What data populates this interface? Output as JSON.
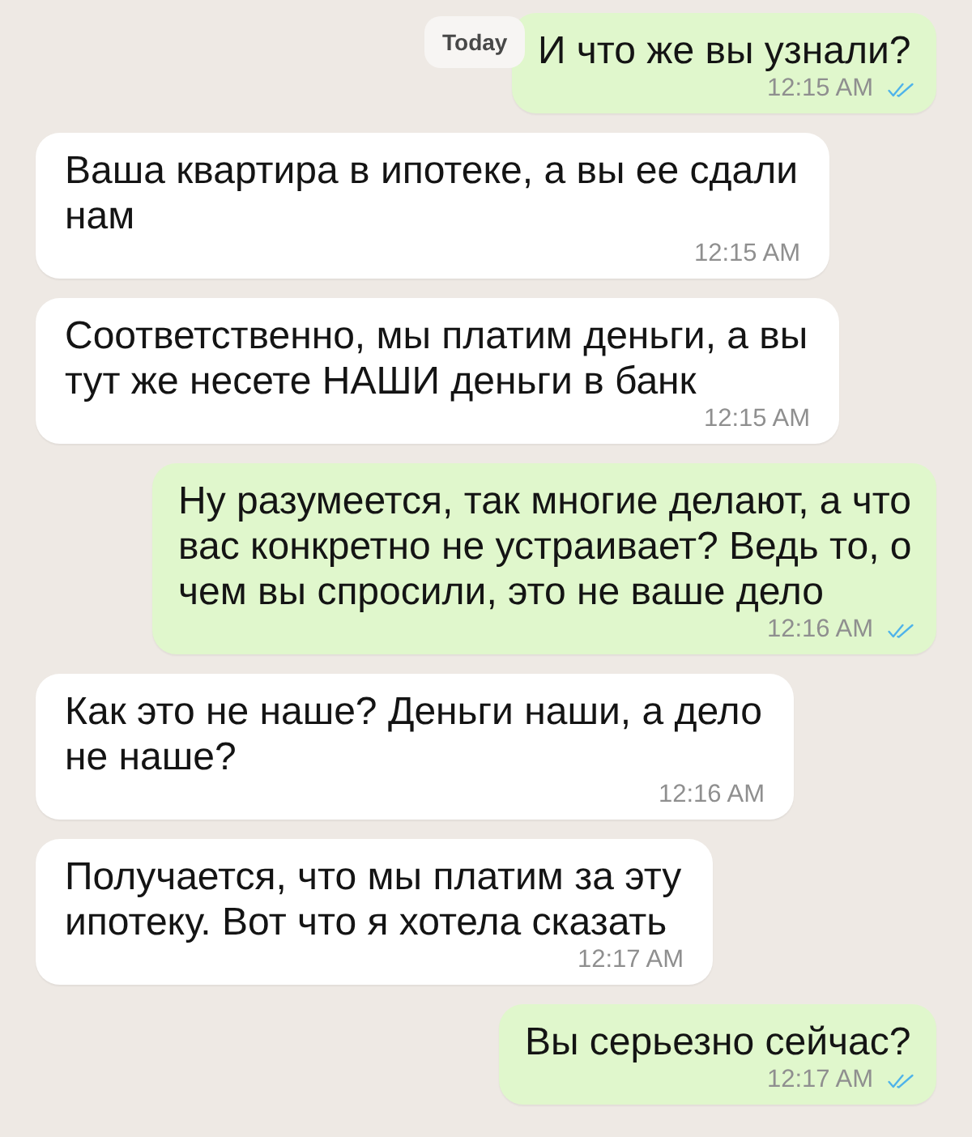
{
  "date_badge": {
    "label": "Today"
  },
  "messages": [
    {
      "kind": "outgoing",
      "text": "И что же вы узнали?",
      "time": "12:15 AM",
      "read": true
    },
    {
      "kind": "incoming",
      "text": "Ваша квартира в ипотеке, а вы ее сдали нам",
      "time": "12:15 AM"
    },
    {
      "kind": "incoming",
      "text": "Соответственно, мы платим деньги, а вы тут же несете НАШИ деньги в банк",
      "time": "12:15 AM"
    },
    {
      "kind": "outgoing",
      "text": "Ну разумеется, так многие делают, а что вас конкретно не устраивает? Ведь то, о чем вы спросили, это не ваше дело",
      "time": "12:16 AM",
      "read": true
    },
    {
      "kind": "incoming",
      "text": "Как это не наше? Деньги наши, а дело не наше?",
      "time": "12:16 AM"
    },
    {
      "kind": "incoming",
      "text": "Получается, что мы платим за эту ипотеку. Вот что я хотела сказать",
      "time": "12:17 AM"
    },
    {
      "kind": "outgoing",
      "text": "Вы серьезно сейчас?",
      "time": "12:17 AM",
      "read": true
    }
  ]
}
